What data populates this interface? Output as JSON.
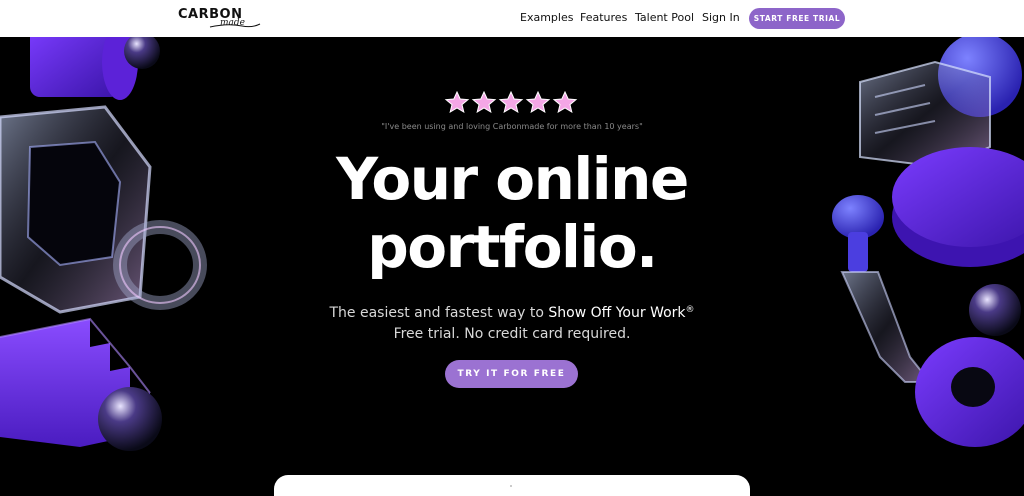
{
  "nav": {
    "logo": {
      "main": "CARBON",
      "sub": "made"
    },
    "links": [
      "Examples",
      "Features",
      "Talent Pool",
      "Sign In"
    ],
    "cta_label": "START FREE TRIAL"
  },
  "hero": {
    "rating_stars": 5,
    "quote": "\"I've been using and loving Carbonmade for more than 10 years\"",
    "headline_line1": "Your online",
    "headline_line2": "portfolio.",
    "subtitle_prefix": "The easiest and fastest way to ",
    "subtitle_highlight": "Show Off Your Work",
    "subtitle_mark": "®",
    "subtitle_line2": "Free trial. No credit card required.",
    "cta_label": "TRY IT FOR FREE"
  },
  "colors": {
    "accent": "#8d65c9",
    "hero_bg": "#000000",
    "deco_purple": "#6a2fe0",
    "star_pink": "#f4a6e6"
  }
}
